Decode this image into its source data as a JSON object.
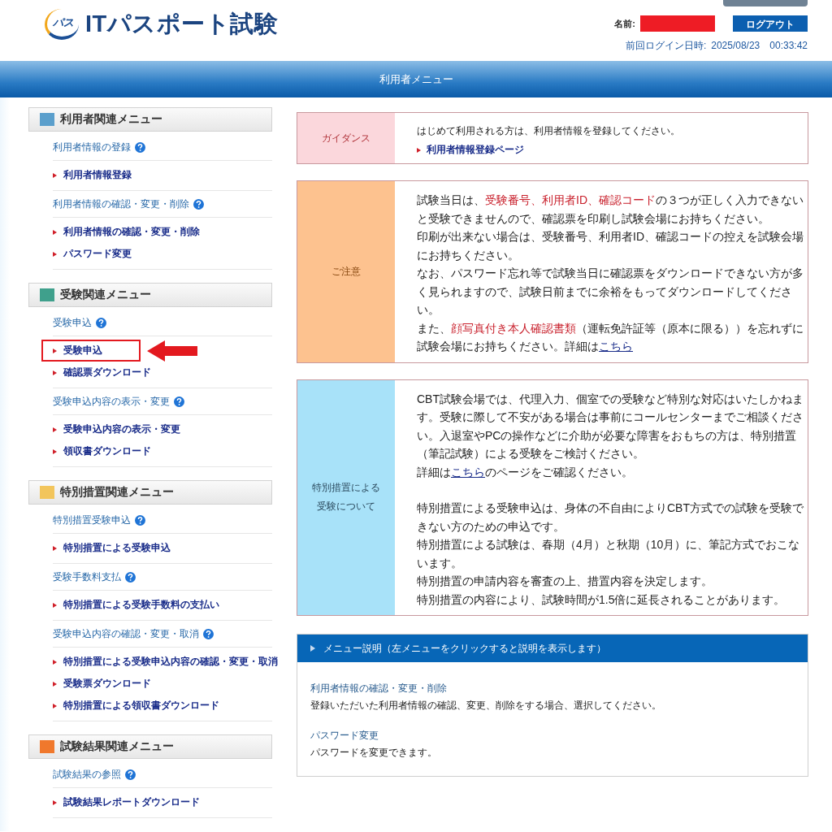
{
  "header": {
    "logo_mark": "パス",
    "title": "ITパスポート試験",
    "name_label": "名前:",
    "logout_button": "ログアウト",
    "last_login_label": "前回ログイン日時:",
    "last_login": "2025/08/23　00:33:42"
  },
  "banner": {
    "title": "利用者メニュー"
  },
  "sidebar": {
    "sections": [
      {
        "title": "利用者関連メニュー",
        "color": "#5b9fcc",
        "groups": [
          {
            "heading": "利用者情報の登録",
            "links": [
              {
                "label": "利用者情報登録",
                "highlighted": false
              }
            ]
          },
          {
            "heading": "利用者情報の確認・変更・削除",
            "links": [
              {
                "label": "利用者情報の確認・変更・削除",
                "highlighted": false
              },
              {
                "label": "パスワード変更",
                "highlighted": false
              }
            ]
          }
        ]
      },
      {
        "title": "受験関連メニュー",
        "color": "#3fa08c",
        "groups": [
          {
            "heading": "受験申込",
            "links": [
              {
                "label": "受験申込",
                "highlighted": true
              },
              {
                "label": "確認票ダウンロード",
                "highlighted": false
              }
            ]
          },
          {
            "heading": "受験申込内容の表示・変更",
            "links": [
              {
                "label": "受験申込内容の表示・変更",
                "highlighted": false
              },
              {
                "label": "領収書ダウンロード",
                "highlighted": false
              }
            ]
          }
        ]
      },
      {
        "title": "特別措置関連メニュー",
        "color": "#f2c55c",
        "groups": [
          {
            "heading": "特別措置受験申込",
            "links": [
              {
                "label": "特別措置による受験申込",
                "highlighted": false
              }
            ]
          },
          {
            "heading": "受験手数料支払",
            "links": [
              {
                "label": "特別措置による受験手数料の支払い",
                "highlighted": false
              }
            ]
          },
          {
            "heading": "受験申込内容の確認・変更・取消",
            "links": [
              {
                "label": "特別措置による受験申込内容の確認・変更・取消",
                "highlighted": false
              },
              {
                "label": "受験票ダウンロード",
                "highlighted": false
              },
              {
                "label": "特別措置による領収書ダウンロード",
                "highlighted": false
              }
            ]
          }
        ]
      },
      {
        "title": "試験結果関連メニュー",
        "color": "#f0782c",
        "groups": [
          {
            "heading": "試験結果の参照",
            "links": [
              {
                "label": "試験結果レポートダウンロード",
                "highlighted": false
              }
            ]
          }
        ]
      }
    ]
  },
  "panels": [
    {
      "kind": "guidance",
      "label": "ガイダンス",
      "note": "はじめて利用される方は、利用者情報を登録してください。",
      "links": [
        "利用者情報登録ページ"
      ]
    },
    {
      "kind": "caution",
      "label": "ご注意",
      "paragraph_groups": [
        [
          [
            {
              "text": "試験当日は、",
              "kind": "plain"
            },
            {
              "text": "受験番号、利用者ID、確認コード",
              "kind": "emphasis"
            },
            {
              "text": "の３つが正しく入力できないと受験できませんので、確認票を印刷し試験会場にお持ちください。",
              "kind": "plain"
            }
          ],
          [
            {
              "text": "印刷が出来ない場合は、受験番号、利用者ID、確認コードの控えを試験会場にお持ちください。",
              "kind": "plain"
            }
          ],
          [
            {
              "text": "なお、パスワード忘れ等で試験当日に確認票をダウンロードできない方が多く見られますので、試験日前までに余裕をもってダウンロードしてください。",
              "kind": "plain"
            }
          ],
          [
            {
              "text": "また、",
              "kind": "plain"
            },
            {
              "text": "顔写真付き本人確認書類",
              "kind": "emphasis"
            },
            {
              "text": "（運転免許証等（原本に限る））を忘れずに試験会場にお持ちください。詳細は",
              "kind": "plain"
            },
            {
              "text": "こちら",
              "kind": "link"
            }
          ]
        ]
      ]
    },
    {
      "kind": "special",
      "label": "特別措置による受験について",
      "paragraph_groups": [
        [
          [
            {
              "text": "CBT試験会場では、代理入力、個室での受験など特別な対応はいたしかねます。受験に際して不安がある場合は事前にコールセンターまでご相談ください。入退室やPCの操作などに介助が必要な障害をおもちの方は、特別措置（筆記試験）による受験をご検討ください。",
              "kind": "plain"
            }
          ],
          [
            {
              "text": "詳細は",
              "kind": "plain"
            },
            {
              "text": "こちら",
              "kind": "link"
            },
            {
              "text": "のページをご確認ください。",
              "kind": "plain"
            }
          ]
        ],
        [
          [
            {
              "text": "特別措置による受験申込は、身体の不自由によりCBT方式での試験を受験できない方のための申込です。",
              "kind": "plain"
            }
          ],
          [
            {
              "text": "特別措置による試験は、春期（4月）と秋期（10月）に、筆記方式でおこないます。",
              "kind": "plain"
            }
          ],
          [
            {
              "text": "特別措置の申請内容を審査の上、措置内容を決定します。",
              "kind": "plain"
            }
          ],
          [
            {
              "text": "特別措置の内容により、試験時間が1.5倍に延長されることがあります。",
              "kind": "plain"
            }
          ]
        ]
      ]
    }
  ],
  "menu_description": {
    "title": "メニュー説明（左メニューをクリックすると説明を表示します）",
    "entries": [
      {
        "title": "利用者情報の確認・変更・削除",
        "text": "登録いただいた利用者情報の確認、変更、削除をする場合、選択してください。"
      },
      {
        "title": "パスワード変更",
        "text": "パスワードを変更できます。"
      }
    ]
  }
}
